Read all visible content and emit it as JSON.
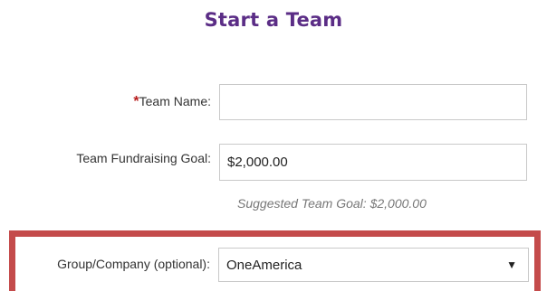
{
  "page": {
    "title": "Start a Team"
  },
  "form": {
    "team_name": {
      "required_marker": "*",
      "label": "Team Name:",
      "value": ""
    },
    "fundraising_goal": {
      "label": "Team Fundraising Goal:",
      "value": "$2,000.00",
      "hint": "Suggested Team Goal: $2,000.00"
    },
    "group_company": {
      "label": "Group/Company (optional):",
      "selected": "OneAmerica",
      "arrow_icon": "triangle-down"
    }
  },
  "colors": {
    "title": "#5b2d86",
    "required": "#b71c1c",
    "highlight_border": "#c44b4b",
    "input_border": "#c9c9c9",
    "hint_text": "#777777"
  }
}
